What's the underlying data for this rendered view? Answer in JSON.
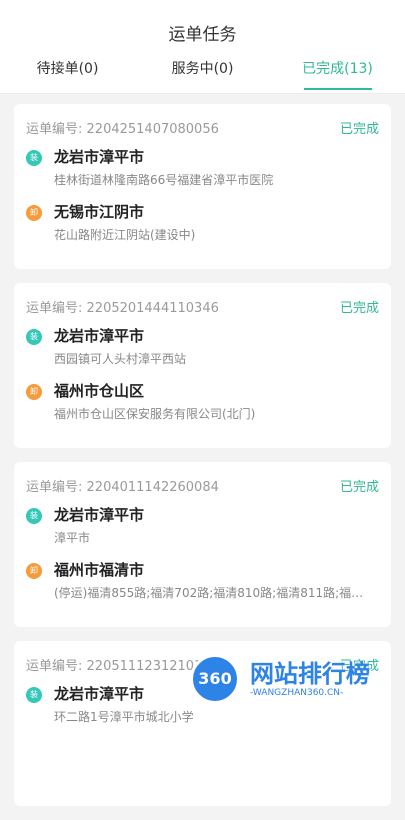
{
  "header": {
    "title": "运单任务",
    "tabs": [
      {
        "label": "待接单(0)"
      },
      {
        "label": "服务中(0)"
      },
      {
        "label": "已完成(13)"
      }
    ]
  },
  "colors": {
    "accent": "#2fb996",
    "load_badge": "#35c7b8",
    "unload_badge": "#f59b3c"
  },
  "orders": [
    {
      "order_label": "运单编号:",
      "order_no": "2204251407080056",
      "status": "已完成",
      "load_badge": "装",
      "load_city": "龙岩市漳平市",
      "load_addr": "桂林街道林隆南路66号福建省漳平市医院",
      "unload_badge": "卸",
      "unload_city": "无锡市江阴市",
      "unload_addr": "花山路附近江阴站(建设中)"
    },
    {
      "order_label": "运单编号:",
      "order_no": "2205201444110346",
      "status": "已完成",
      "load_badge": "装",
      "load_city": "龙岩市漳平市",
      "load_addr": "西园镇可人头村漳平西站",
      "unload_badge": "卸",
      "unload_city": "福州市仓山区",
      "unload_addr": "福州市仓山区保安服务有限公司(北门)"
    },
    {
      "order_label": "运单编号:",
      "order_no": "2204011142260084",
      "status": "已完成",
      "load_badge": "装",
      "load_city": "龙岩市漳平市",
      "load_addr": "漳平市",
      "unload_badge": "卸",
      "unload_city": "福州市福清市",
      "unload_addr": "(停运)福清855路;福清702路;福清810路;福清811路;福…"
    },
    {
      "order_label": "运单编号:",
      "order_no": "220511123121018",
      "status": "已完成",
      "load_badge": "装",
      "load_city": "龙岩市漳平市",
      "load_addr": "环二路1号漳平市城北小学"
    }
  ],
  "watermark": {
    "logo": "360",
    "name": "网站排行榜",
    "domain": "-WANGZHAN360.CN-"
  }
}
